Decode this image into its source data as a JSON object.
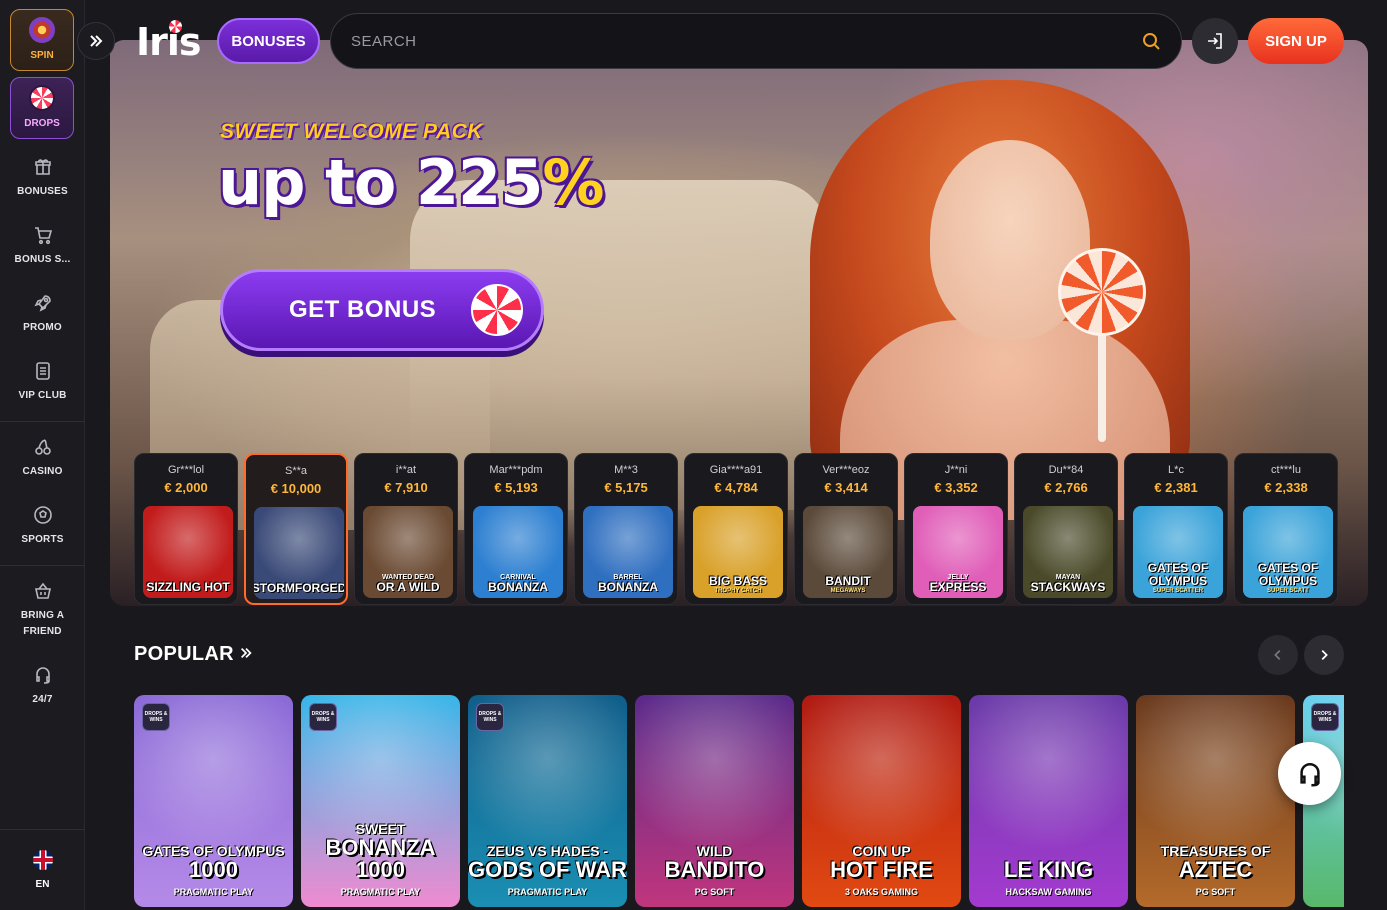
{
  "sidebar": {
    "spin_label": "SPIN",
    "drops_label": "DROPS",
    "items": [
      {
        "label": "BONUSES"
      },
      {
        "label": "BONUS S..."
      },
      {
        "label": "PROMO"
      },
      {
        "label": "VIP CLUB"
      },
      {
        "label": "CASINO"
      },
      {
        "label": "SPORTS"
      },
      {
        "label": "BRING A FRIEND"
      },
      {
        "label": "24/7"
      }
    ],
    "language": "EN"
  },
  "header": {
    "logo": "Iris",
    "bonuses_label": "BONUSES",
    "search_placeholder": "SEARCH",
    "signup_label": "SIGN UP"
  },
  "hero": {
    "tag": "SWEET WELCOME PACK",
    "title_main": "up to 225",
    "title_pct": "%",
    "cta_label": "GET BONUS"
  },
  "recent_wins": [
    {
      "user": "",
      "amount": "",
      "game_t1": "",
      "game_t2": "",
      "game_t3": "",
      "color": "#c0391b"
    },
    {
      "user": "Gr***lol",
      "amount": "€ 2,000",
      "game_t1": "",
      "game_t2": "SIZZLING HOT",
      "game_t3": "",
      "color": "#c21b1b"
    },
    {
      "user": "S**a",
      "amount": "€ 10,000",
      "game_t1": "",
      "game_t2": "STORMFORGED",
      "game_t3": "",
      "color": "#3a4a78"
    },
    {
      "user": "i**at",
      "amount": "€ 7,910",
      "game_t1": "WANTED DEAD",
      "game_t2": "OR A WILD",
      "game_t3": "",
      "color": "#6a4a32"
    },
    {
      "user": "Mar***pdm",
      "amount": "€ 5,193",
      "game_t1": "CARNIVAL",
      "game_t2": "BONANZA",
      "game_t3": "",
      "color": "#2c7fd1"
    },
    {
      "user": "M**3",
      "amount": "€ 5,175",
      "game_t1": "BARREL",
      "game_t2": "BONANZA",
      "game_t3": "",
      "color": "#2f6fc0"
    },
    {
      "user": "Gia****a91",
      "amount": "€ 4,784",
      "game_t1": "",
      "game_t2": "BIG BASS",
      "game_t3": "TROPHY CATCH",
      "color": "#d9a12a"
    },
    {
      "user": "Ver***eoz",
      "amount": "€ 3,414",
      "game_t1": "",
      "game_t2": "BANDIT",
      "game_t3": "MEGAWAYS",
      "color": "#5b4a3a"
    },
    {
      "user": "J**ni",
      "amount": "€ 3,352",
      "game_t1": "JELLY",
      "game_t2": "EXPRESS",
      "game_t3": "",
      "color": "#e05db8"
    },
    {
      "user": "Du**84",
      "amount": "€ 2,766",
      "game_t1": "MAYAN",
      "game_t2": "STACKWAYS",
      "game_t3": "",
      "color": "#4a4a2a"
    },
    {
      "user": "L*c",
      "amount": "€ 2,381",
      "game_t1": "",
      "game_t2": "GATES OF OLYMPUS",
      "game_t3": "SUPER SCATTER",
      "color": "#3aa3d9"
    },
    {
      "user": "ct***lu",
      "amount": "€ 2,338",
      "game_t1": "",
      "game_t2": "GATES OF OLYMPUS",
      "game_t3": "SUPER SCATT",
      "color": "#3aa3d9"
    }
  ],
  "popular": {
    "title": "POPULAR",
    "games": [
      {
        "badge": "DROPS & WINS",
        "g1": "GATES OF OLYMPUS",
        "g2": "1000",
        "provider": "PRAGMATIC PLAY",
        "c1": "#8a6ad6",
        "c2": "#b58ae8"
      },
      {
        "badge": "DROPS & WINS",
        "g1": "SWEET",
        "g2": "BONANZA 1000",
        "provider": "PRAGMATIC PLAY",
        "c1": "#38b6e8",
        "c2": "#f08bd0"
      },
      {
        "badge": "DROPS & WINS",
        "g1": "ZEUS VS HADES -",
        "g2": "GODS OF WAR",
        "provider": "PRAGMATIC PLAY",
        "c1": "#0f5d8a",
        "c2": "#1b8fb3"
      },
      {
        "badge": "",
        "g1": "WILD",
        "g2": "BANDITO",
        "provider": "PG SOFT",
        "c1": "#5a2a8a",
        "c2": "#c0367d"
      },
      {
        "badge": "",
        "g1": "COIN UP",
        "g2": "HOT FIRE",
        "provider": "3 OAKS GAMING",
        "c1": "#b01a12",
        "c2": "#e24a12"
      },
      {
        "badge": "",
        "g1": "",
        "g2": "LE KING",
        "provider": "HACKSAW GAMING",
        "c1": "#6a3aa8",
        "c2": "#a43ad0"
      },
      {
        "badge": "",
        "g1": "TREASURES OF",
        "g2": "AZTEC",
        "provider": "PG SOFT",
        "c1": "#6a3a1e",
        "c2": "#b46a2a"
      },
      {
        "badge": "DROPS & WINS",
        "g1": "",
        "g2": "",
        "provider": "",
        "c1": "#6ad0f0",
        "c2": "#58b86a"
      }
    ]
  }
}
